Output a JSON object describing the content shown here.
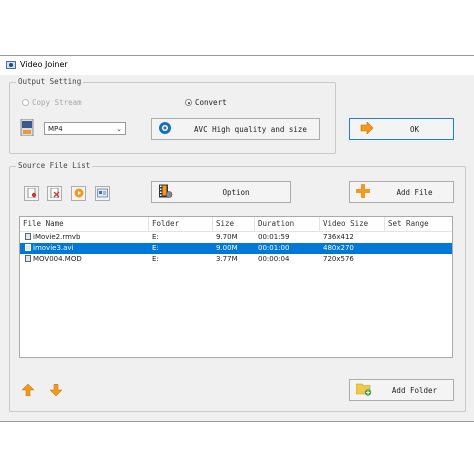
{
  "window": {
    "title": "Video Joiner"
  },
  "output_setting": {
    "label": "Output Setting",
    "copy_stream_label": "Copy Stream",
    "convert_label": "Convert",
    "selected_mode": "convert",
    "format_value": "MP4",
    "quality_button_label": "AVC High quality and size",
    "ok_label": "OK"
  },
  "source_file_list": {
    "label": "Source File List",
    "option_label": "Option",
    "add_file_label": "Add File",
    "add_folder_label": "Add Folder",
    "columns": [
      "File Name",
      "Folder",
      "Size",
      "Duration",
      "Video Size",
      "Set Range"
    ],
    "rows": [
      {
        "file_name": "iMovie2.rmvb",
        "folder": "E:",
        "size": "9.70M",
        "duration": "00:01:59",
        "video_size": "736x412",
        "set_range": ""
      },
      {
        "file_name": "imovie3.avi",
        "folder": "E:",
        "size": "9.00M",
        "duration": "00:01:00",
        "video_size": "480x270",
        "set_range": "",
        "selected": true
      },
      {
        "file_name": "MOV004.MOD",
        "folder": "E:",
        "size": "3.77M",
        "duration": "00:00:04",
        "video_size": "720x576",
        "set_range": ""
      }
    ]
  },
  "colors": {
    "selection": "#0078d7",
    "accent_orange": "#f29a1f",
    "focus_border": "#1e7fd6"
  }
}
